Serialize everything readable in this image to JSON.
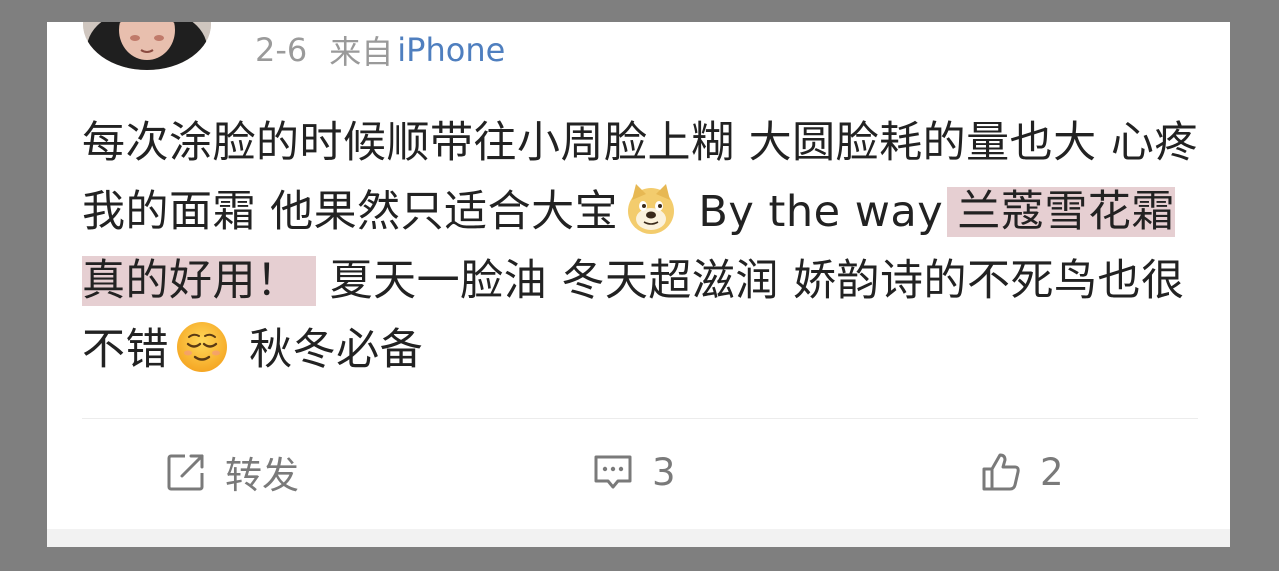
{
  "post": {
    "date": "2-6",
    "source_prefix": "来自",
    "device": "iPhone",
    "text": {
      "line_a": "每次涂脸的时候顺带往小周脸上糊 大圆脸耗的量也大 心疼我的面霜 他果然只适合大宝",
      "emoji_1": "doge-emoji",
      "line_b": " By the way ",
      "highlight": "兰蔻雪花霜真的好用！",
      "line_c": " 夏天一脸油 冬天超滋润 娇韵诗的不死鸟也很不错",
      "emoji_2": "relieved-face-emoji",
      "line_d": " 秋冬必备"
    }
  },
  "actions": {
    "repost_label": "转发",
    "comment_count": "3",
    "like_count": "2"
  },
  "colors": {
    "background_outer": "#7f7f7f",
    "card": "#ffffff",
    "meta_text": "#9a9a9a",
    "link_blue": "#4f7fbf",
    "highlight": "#e6cfd2",
    "body_text": "#222222",
    "action_text": "#7a7a7a"
  },
  "icons": {
    "repost": "share-arrow-icon",
    "comment": "comment-bubble-icon",
    "like": "thumbs-up-icon"
  }
}
